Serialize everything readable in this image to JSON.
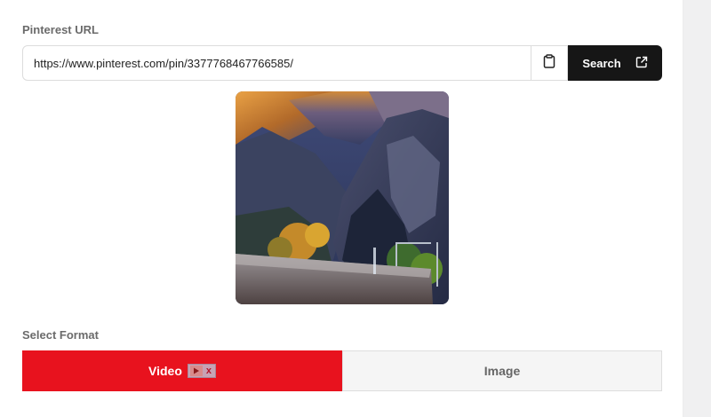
{
  "url_section": {
    "label": "Pinterest URL",
    "input_value": "https://www.pinterest.com/pin/3377768467766585/",
    "search_label": "Search"
  },
  "format_section": {
    "label": "Select Format",
    "options": [
      {
        "label": "Video",
        "selected": true
      },
      {
        "label": "Image",
        "selected": false
      }
    ]
  },
  "colors": {
    "accent": "#e8121e",
    "button_dark": "#161616"
  },
  "icons": {
    "paste": "clipboard-icon",
    "external": "external-link-icon"
  }
}
